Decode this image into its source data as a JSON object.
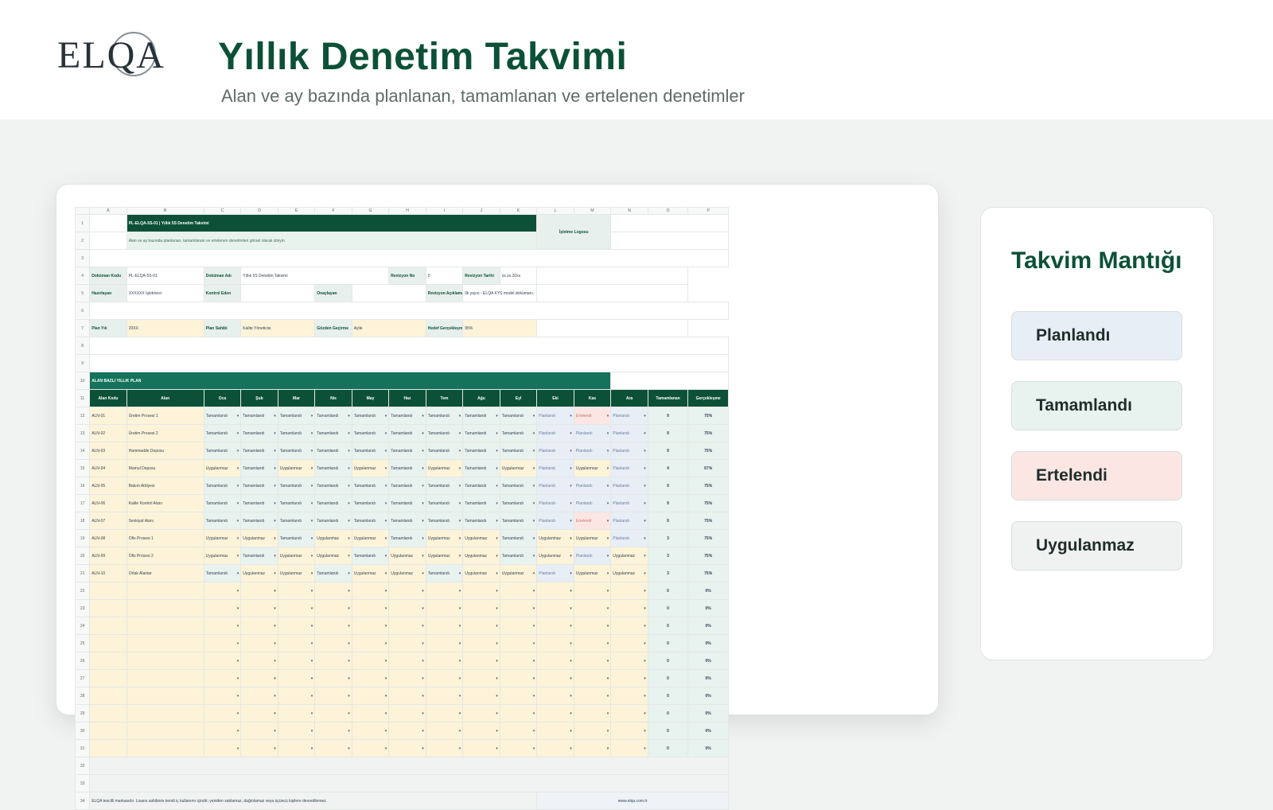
{
  "header": {
    "logo_text": "ELQA",
    "title": "Yıllık Denetim Takvimi",
    "subtitle": "Alan ve ay bazında planlanan, tamamlanan ve ertelenen denetimler"
  },
  "sheet": {
    "columns": [
      "A",
      "B",
      "C",
      "D",
      "E",
      "F",
      "G",
      "H",
      "I",
      "J",
      "K",
      "L",
      "M",
      "N",
      "O",
      "P"
    ],
    "doc_title": "PL-ELQA-5S-01 | Yıllık 5S Denetim Takvimi",
    "doc_desc": "Alan ve ay bazında planlanan, tamamlanan ve ertelenen denetimleri görsel olarak izleyin.",
    "logo_cell": "İşletme Logosu",
    "meta": {
      "doc_code_label": "Doküman Kodu",
      "doc_code": "PL-ELQA-5S-01",
      "doc_name_label": "Doküman Adı",
      "doc_name": "Yıllık 5S Denetim Takvimi",
      "rev_no_label": "Revizyon No",
      "rev_no": "0",
      "rev_date_label": "Revizyon Tarihi",
      "rev_date": "xx.xx.20xx",
      "prepared_label": "Hazırlayan",
      "prepared": "XXXXXX İşletmesi",
      "control_label": "Kontrol Eden",
      "approve_label": "Onaylayan",
      "rev_desc_label": "Revizyon Açıklaması",
      "rev_desc": "İlk yayın - ELQA KYS model dokümanı.",
      "plan_year_label": "Plan Yılı",
      "plan_year": "20XX",
      "plan_owner_label": "Plan Sahibi",
      "plan_owner": "Kalite Yöneticisi",
      "review_label": "Gözden Geçirme",
      "review": "Aylık",
      "target_label": "Hedef Gerçekleşme",
      "target": "95%"
    },
    "section_title": "ALAN BAZLI YILLIK PLAN",
    "table_headers": [
      "Alan Kodu",
      "Alan",
      "Oca",
      "Şub",
      "Mar",
      "Nis",
      "May",
      "Haz",
      "Tem",
      "Ağu",
      "Eyl",
      "Eki",
      "Kas",
      "Ara",
      "Tamamlanan",
      "Gerçekleşme"
    ],
    "rows": [
      {
        "code": "ALN-01",
        "name": "Üretim Prosesi 1",
        "months": [
          "T",
          "T",
          "T",
          "T",
          "T",
          "T",
          "T",
          "T",
          "T",
          "P",
          "E",
          "P"
        ],
        "done": "9",
        "pct": "75%"
      },
      {
        "code": "ALN-02",
        "name": "Üretim Prosesi 2",
        "months": [
          "T",
          "T",
          "T",
          "T",
          "T",
          "T",
          "T",
          "T",
          "T",
          "P",
          "P",
          "P"
        ],
        "done": "9",
        "pct": "75%"
      },
      {
        "code": "ALN-03",
        "name": "Hammadde Deposu",
        "months": [
          "T",
          "T",
          "T",
          "T",
          "T",
          "T",
          "T",
          "T",
          "T",
          "P",
          "P",
          "P"
        ],
        "done": "9",
        "pct": "75%"
      },
      {
        "code": "ALN-04",
        "name": "Mamul Deposu",
        "months": [
          "U",
          "T",
          "U",
          "T",
          "U",
          "T",
          "U",
          "T",
          "U",
          "P",
          "U",
          "P"
        ],
        "done": "4",
        "pct": "67%"
      },
      {
        "code": "ALN-05",
        "name": "Bakım Atölyesi",
        "months": [
          "T",
          "T",
          "T",
          "T",
          "T",
          "T",
          "T",
          "T",
          "T",
          "P",
          "P",
          "P"
        ],
        "done": "9",
        "pct": "75%"
      },
      {
        "code": "ALN-06",
        "name": "Kalite Kontrol Alanı",
        "months": [
          "T",
          "T",
          "T",
          "T",
          "T",
          "T",
          "T",
          "T",
          "T",
          "P",
          "P",
          "P"
        ],
        "done": "9",
        "pct": "75%"
      },
      {
        "code": "ALN-07",
        "name": "Sevkiyat Alanı",
        "months": [
          "T",
          "T",
          "T",
          "T",
          "T",
          "T",
          "T",
          "T",
          "T",
          "P",
          "E",
          "P"
        ],
        "done": "9",
        "pct": "75%"
      },
      {
        "code": "ALN-08",
        "name": "Ofis Prosesi 1",
        "months": [
          "U",
          "U",
          "T",
          "U",
          "U",
          "T",
          "U",
          "U",
          "T",
          "U",
          "U",
          "P"
        ],
        "done": "3",
        "pct": "75%"
      },
      {
        "code": "ALN-09",
        "name": "Ofis Prosesi 2",
        "months": [
          "U",
          "T",
          "U",
          "U",
          "T",
          "U",
          "U",
          "U",
          "T",
          "U",
          "P",
          "U"
        ],
        "done": "3",
        "pct": "75%"
      },
      {
        "code": "ALN-10",
        "name": "Ortak Alanlar",
        "months": [
          "T",
          "U",
          "U",
          "T",
          "U",
          "U",
          "T",
          "U",
          "U",
          "P",
          "U",
          "U"
        ],
        "done": "3",
        "pct": "75%"
      }
    ],
    "status_labels": {
      "T": "Tamamlandı",
      "P": "Planlandı",
      "E": "Ertelendi",
      "U": "Uygulanmaz"
    },
    "empty_done": "0",
    "empty_pct": "0%",
    "footer_note": "ELQA tescilli markasıdır. Lisans sahibinin kendi iç kullanımı içindir; yeniden satılamaz, dağıtılamaz veya üçüncü kişilere devredilemez.",
    "footer_url": "www.elqa.com.tr"
  },
  "legend": {
    "title": "Takvim Mantığı",
    "items": [
      "Planlandı",
      "Tamamlandı",
      "Ertelendi",
      "Uygulanmaz"
    ]
  }
}
